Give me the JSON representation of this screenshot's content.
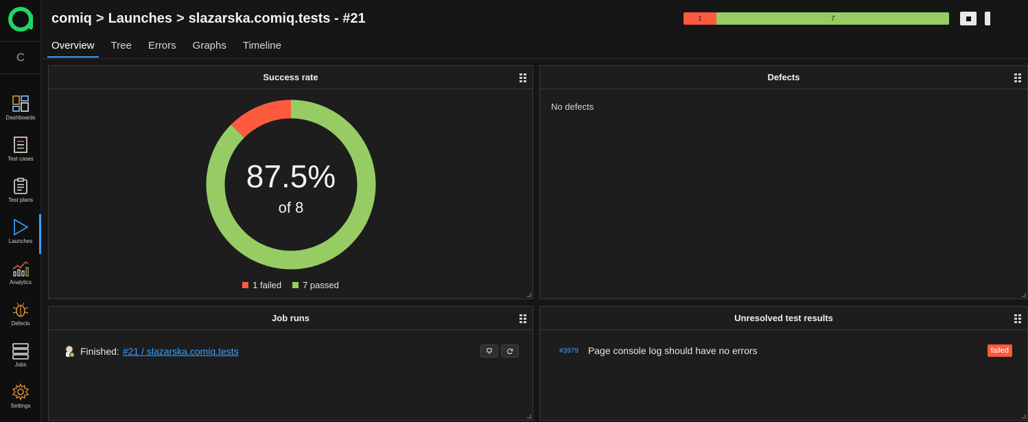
{
  "sidebar": {
    "project_letter": "C",
    "items": [
      {
        "label": "Dashboards",
        "icon": "dashboard-icon"
      },
      {
        "label": "Test cases",
        "icon": "test-cases-icon"
      },
      {
        "label": "Test plans",
        "icon": "test-plans-icon"
      },
      {
        "label": "Launches",
        "icon": "play-icon",
        "active": true
      },
      {
        "label": "Analytics",
        "icon": "analytics-icon"
      },
      {
        "label": "Defects",
        "icon": "bug-icon"
      },
      {
        "label": "Jobs",
        "icon": "jobs-icon"
      },
      {
        "label": "Settings",
        "icon": "gear-icon"
      }
    ]
  },
  "header": {
    "breadcrumb": [
      "comiq",
      "Launches",
      "slazarska.comiq.tests - #21"
    ],
    "tabs": [
      "Overview",
      "Tree",
      "Errors",
      "Graphs",
      "Timeline"
    ],
    "active_tab": "Overview",
    "status_bar": {
      "failed": "1",
      "passed": "7",
      "failed_fraction": 0.125
    }
  },
  "panels": {
    "success": {
      "title": "Success rate",
      "percent": "87.5%",
      "of_text": "of 8",
      "legend_failed": "1 failed",
      "legend_passed": "7 passed"
    },
    "defects": {
      "title": "Defects",
      "empty_text": "No defects"
    },
    "jobs": {
      "title": "Job runs",
      "status_text": "Finished:",
      "link_text": "#21 / slazarska.comiq.tests"
    },
    "unresolved": {
      "title": "Unresolved test results",
      "row": {
        "id": "#3979",
        "name": "Page console log should have no errors",
        "status": "failed"
      }
    }
  },
  "colors": {
    "failed": "#fd5a3e",
    "passed": "#97cc64",
    "accent": "#3aa0ff",
    "logo": "#1ed760"
  },
  "chart_data": {
    "type": "pie",
    "categories": [
      "failed",
      "passed"
    ],
    "values": [
      1,
      7
    ],
    "total": 8
  }
}
